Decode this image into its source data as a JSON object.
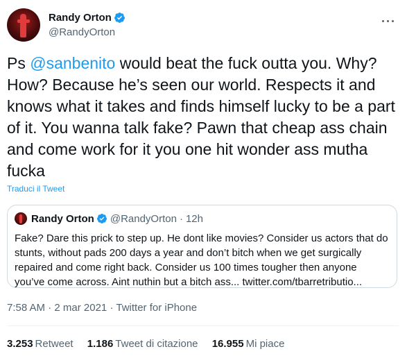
{
  "tweet": {
    "author": {
      "name": "Randy Orton",
      "handle": "@RandyOrton"
    },
    "text_before": "Ps ",
    "mention": "@sanbenito",
    "text_after": " would beat the fuck outta you. Why? How? Because he’s seen our world. Respects it and knows what it takes and finds himself lucky to be a part of it. You wanna talk fake? Pawn that cheap ass chain and come work for it you one hit wonder ass mutha fucka",
    "translate_label": "Traduci il Tweet",
    "time": "7:58 AM",
    "date": "2 mar 2021",
    "source": "Twitter for iPhone",
    "meta_sep": "·"
  },
  "quote": {
    "name": "Randy Orton",
    "handle": "@RandyOrton",
    "sep": "·",
    "time": "12h",
    "text": "Fake? Dare this prick to step up. He dont like movies? Consider us actors that do stunts, without pads 200 days a year and don’t bitch when we get surgically repaired and come right back. Consider us 100 times tougher then anyone you’ve come across. Aint nuthin but a bitch ass... twitter.com/tbarretributio..."
  },
  "stats": {
    "retweets": {
      "count": "3.253",
      "label": "Retweet"
    },
    "quotes": {
      "count": "1.186",
      "label": "Tweet di citazione"
    },
    "likes": {
      "count": "16.955",
      "label": "Mi piace"
    }
  },
  "icons": {
    "verified": "verified-badge-icon",
    "more": "more-options-icon"
  },
  "colors": {
    "accent": "#1d9bf0",
    "secondary_text": "#536471",
    "border": "#cfd9de"
  }
}
